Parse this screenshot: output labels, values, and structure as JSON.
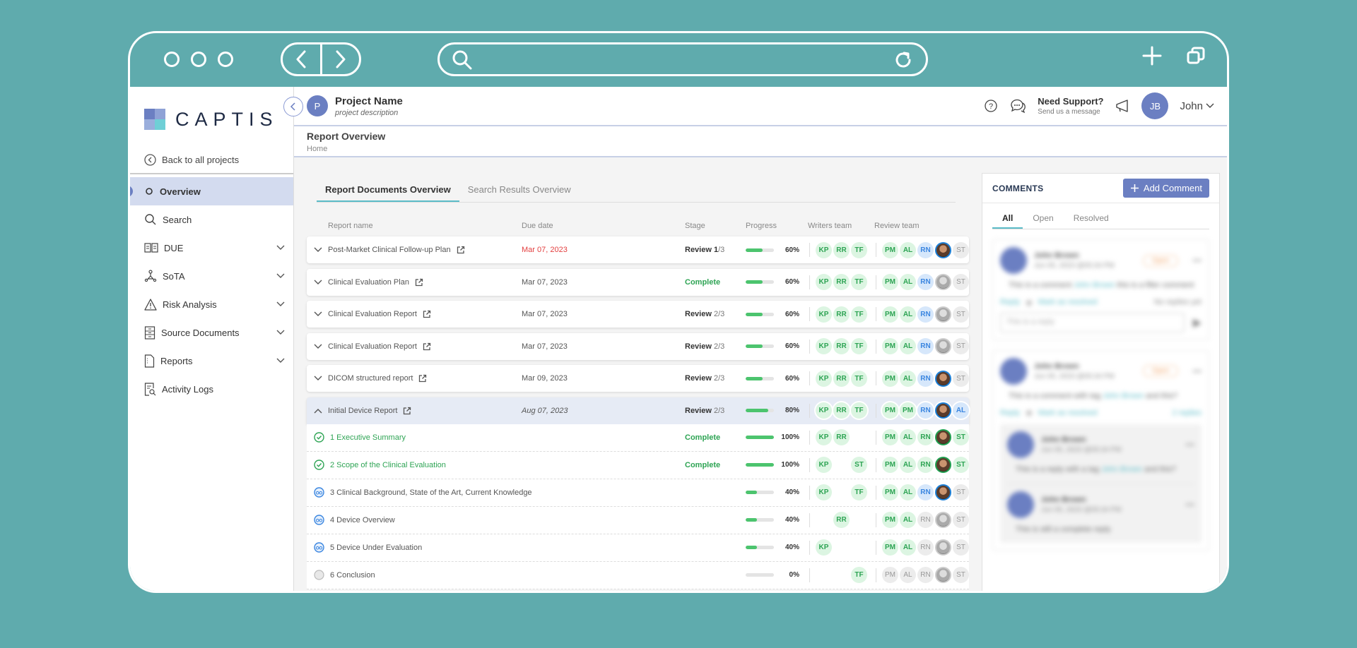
{
  "browser": {
    "icons": [
      "window-dot-icon",
      "back-icon",
      "forward-icon",
      "search-icon",
      "reload-icon",
      "new-tab-icon",
      "tabs-icon"
    ]
  },
  "sidebar": {
    "logo_text": "CAPTIS",
    "back_label": "Back to all projects",
    "items": [
      {
        "label": "Overview",
        "icon": "circle-icon",
        "active": true,
        "expandable": false
      },
      {
        "label": "Search",
        "icon": "search-icon",
        "active": false,
        "expandable": false
      },
      {
        "label": "DUE",
        "icon": "book-icon",
        "active": false,
        "expandable": true
      },
      {
        "label": "SoTA",
        "icon": "network-icon",
        "active": false,
        "expandable": true
      },
      {
        "label": "Risk Analysis",
        "icon": "warning-icon",
        "active": false,
        "expandable": true
      },
      {
        "label": "Source Documents",
        "icon": "cabinet-icon",
        "active": false,
        "expandable": true
      },
      {
        "label": "Reports",
        "icon": "document-icon",
        "active": false,
        "expandable": true
      },
      {
        "label": "Activity Logs",
        "icon": "log-search-icon",
        "active": false,
        "expandable": false
      }
    ]
  },
  "topbar": {
    "project_initial": "P",
    "project_name": "Project Name",
    "project_description": "project description",
    "support_title": "Need Support?",
    "support_subtitle": "Send us a message",
    "user_initials": "JB",
    "user_name": "John"
  },
  "page": {
    "title": "Report Overview",
    "breadcrumb": "Home"
  },
  "tabs": [
    {
      "label": "Report Documents Overview",
      "active": true
    },
    {
      "label": "Search Results Overview",
      "active": false
    }
  ],
  "table": {
    "headers": {
      "name": "Report name",
      "due": "Due date",
      "stage": "Stage",
      "progress": "Progress",
      "writers": "Writers team",
      "review": "Review team"
    },
    "rows": [
      {
        "name": "Post-Market Clinical Follow-up Plan",
        "due": "Mar 07, 2023",
        "due_state": "overdue",
        "stage": {
          "type": "review",
          "word": "Review",
          "current": "1",
          "total": "/3"
        },
        "progress": 60,
        "progress_label": "60%",
        "writers": [
          {
            "i": "KP",
            "c": "green"
          },
          {
            "i": "RR",
            "c": "green"
          },
          {
            "i": "TF",
            "c": "green"
          }
        ],
        "review": [
          {
            "i": "PM",
            "c": "green"
          },
          {
            "i": "AL",
            "c": "green"
          },
          {
            "i": "RN",
            "c": "blue"
          },
          {
            "i": "",
            "c": "photo"
          },
          {
            "i": "ST",
            "c": "gray"
          }
        ]
      },
      {
        "name": "Clinical Evaluation Plan",
        "due": "Mar 07, 2023",
        "due_state": "normal",
        "stage": {
          "type": "complete",
          "word": "Complete"
        },
        "progress": 60,
        "progress_label": "60%",
        "writers": [
          {
            "i": "KP",
            "c": "green"
          },
          {
            "i": "RR",
            "c": "green"
          },
          {
            "i": "TF",
            "c": "green"
          }
        ],
        "review": [
          {
            "i": "PM",
            "c": "green"
          },
          {
            "i": "AL",
            "c": "green"
          },
          {
            "i": "RN",
            "c": "blue"
          },
          {
            "i": "",
            "c": "photo-gray"
          },
          {
            "i": "ST",
            "c": "gray"
          }
        ]
      },
      {
        "name": "Clinical Evaluation Report",
        "due": "Mar 07, 2023",
        "due_state": "normal",
        "stage": {
          "type": "review",
          "word": "Review",
          "current": "",
          "total": "2/3"
        },
        "progress": 60,
        "progress_label": "60%",
        "writers": [
          {
            "i": "KP",
            "c": "green"
          },
          {
            "i": "RR",
            "c": "green"
          },
          {
            "i": "TF",
            "c": "green"
          }
        ],
        "review": [
          {
            "i": "PM",
            "c": "green"
          },
          {
            "i": "AL",
            "c": "green"
          },
          {
            "i": "RN",
            "c": "blue"
          },
          {
            "i": "",
            "c": "photo-gray"
          },
          {
            "i": "ST",
            "c": "gray"
          }
        ]
      },
      {
        "name": "Clinical Evaluation Report",
        "due": "Mar 07, 2023",
        "due_state": "normal",
        "stage": {
          "type": "review",
          "word": "Review",
          "current": "",
          "total": "2/3"
        },
        "progress": 60,
        "progress_label": "60%",
        "writers": [
          {
            "i": "KP",
            "c": "green"
          },
          {
            "i": "RR",
            "c": "green"
          },
          {
            "i": "TF",
            "c": "green"
          }
        ],
        "review": [
          {
            "i": "PM",
            "c": "green"
          },
          {
            "i": "AL",
            "c": "green"
          },
          {
            "i": "RN",
            "c": "blue"
          },
          {
            "i": "",
            "c": "photo-gray"
          },
          {
            "i": "ST",
            "c": "gray"
          }
        ]
      },
      {
        "name": "DICOM structured report",
        "due": "Mar 09, 2023",
        "due_state": "normal",
        "stage": {
          "type": "review",
          "word": "Review",
          "current": "",
          "total": "2/3"
        },
        "progress": 60,
        "progress_label": "60%",
        "writers": [
          {
            "i": "KP",
            "c": "green"
          },
          {
            "i": "RR",
            "c": "green"
          },
          {
            "i": "TF",
            "c": "green"
          }
        ],
        "review": [
          {
            "i": "PM",
            "c": "green"
          },
          {
            "i": "AL",
            "c": "green"
          },
          {
            "i": "RN",
            "c": "blue"
          },
          {
            "i": "",
            "c": "photo"
          },
          {
            "i": "ST",
            "c": "gray"
          }
        ]
      },
      {
        "name": "Initial Device Report",
        "due": "Aug 07, 2023",
        "due_state": "italic",
        "expanded": true,
        "stage": {
          "type": "review",
          "word": "Review",
          "current": "",
          "total": "2/3"
        },
        "progress": 80,
        "progress_label": "80%",
        "writers": [
          {
            "i": "KP",
            "c": "green"
          },
          {
            "i": "RR",
            "c": "green"
          },
          {
            "i": "TF",
            "c": "green"
          }
        ],
        "review": [
          {
            "i": "PM",
            "c": "green"
          },
          {
            "i": "PM",
            "c": "green"
          },
          {
            "i": "RN",
            "c": "blue"
          },
          {
            "i": "",
            "c": "photo"
          },
          {
            "i": "AL",
            "c": "blue"
          }
        ],
        "sections": [
          {
            "name": "1 Executive Summary",
            "status": "complete",
            "stage": "Complete",
            "progress": 100,
            "progress_label": "100%",
            "writers": [
              {
                "i": "KP",
                "c": "green"
              },
              {
                "i": "RR",
                "c": "green"
              },
              {
                "i": "",
                "c": "empty"
              }
            ],
            "review": [
              {
                "i": "PM",
                "c": "green"
              },
              {
                "i": "AL",
                "c": "green"
              },
              {
                "i": "RN",
                "c": "green"
              },
              {
                "i": "",
                "c": "photo-green"
              },
              {
                "i": "ST",
                "c": "green"
              }
            ]
          },
          {
            "name": "2 Scope of the Clinical Evaluation",
            "status": "complete",
            "stage": "Complete",
            "progress": 100,
            "progress_label": "100%",
            "writers": [
              {
                "i": "KP",
                "c": "green"
              },
              {
                "i": "",
                "c": "empty"
              },
              {
                "i": "ST",
                "c": "green"
              }
            ],
            "review": [
              {
                "i": "PM",
                "c": "green"
              },
              {
                "i": "AL",
                "c": "green"
              },
              {
                "i": "RN",
                "c": "green"
              },
              {
                "i": "",
                "c": "photo-green"
              },
              {
                "i": "ST",
                "c": "green"
              }
            ]
          },
          {
            "name": "3 Clinical Background, State of the Art, Current Knowledge",
            "status": "review",
            "stage": "",
            "progress": 40,
            "progress_label": "40%",
            "writers": [
              {
                "i": "KP",
                "c": "green"
              },
              {
                "i": "",
                "c": "empty"
              },
              {
                "i": "TF",
                "c": "green"
              }
            ],
            "review": [
              {
                "i": "PM",
                "c": "green"
              },
              {
                "i": "AL",
                "c": "green"
              },
              {
                "i": "RN",
                "c": "blue"
              },
              {
                "i": "",
                "c": "photo"
              },
              {
                "i": "ST",
                "c": "gray"
              }
            ]
          },
          {
            "name": "4 Device Overview",
            "status": "review",
            "stage": "",
            "progress": 40,
            "progress_label": "40%",
            "writers": [
              {
                "i": "",
                "c": "empty"
              },
              {
                "i": "RR",
                "c": "green"
              },
              {
                "i": "",
                "c": "empty"
              }
            ],
            "review": [
              {
                "i": "PM",
                "c": "green"
              },
              {
                "i": "AL",
                "c": "green"
              },
              {
                "i": "RN",
                "c": "gray"
              },
              {
                "i": "",
                "c": "photo-gray"
              },
              {
                "i": "ST",
                "c": "gray"
              }
            ]
          },
          {
            "name": "5 Device Under Evaluation",
            "status": "review",
            "stage": "",
            "progress": 40,
            "progress_label": "40%",
            "writers": [
              {
                "i": "KP",
                "c": "green"
              },
              {
                "i": "",
                "c": "empty"
              },
              {
                "i": "",
                "c": "empty"
              }
            ],
            "review": [
              {
                "i": "PM",
                "c": "green"
              },
              {
                "i": "AL",
                "c": "green"
              },
              {
                "i": "RN",
                "c": "gray"
              },
              {
                "i": "",
                "c": "photo-gray"
              },
              {
                "i": "ST",
                "c": "gray"
              }
            ]
          },
          {
            "name": "6 Conclusion",
            "status": "pending",
            "stage": "",
            "progress": 0,
            "progress_label": "0%",
            "writers": [
              {
                "i": "",
                "c": "empty"
              },
              {
                "i": "",
                "c": "empty"
              },
              {
                "i": "TF",
                "c": "green"
              }
            ],
            "review": [
              {
                "i": "PM",
                "c": "gray"
              },
              {
                "i": "AL",
                "c": "gray"
              },
              {
                "i": "RN",
                "c": "gray"
              },
              {
                "i": "",
                "c": "photo-gray"
              },
              {
                "i": "ST",
                "c": "gray"
              }
            ]
          }
        ]
      }
    ]
  },
  "comments": {
    "title": "COMMENTS",
    "add_label": "Add Comment",
    "tabs": [
      {
        "label": "All",
        "active": true
      },
      {
        "label": "Open",
        "active": false
      },
      {
        "label": "Resolved",
        "active": false
      }
    ],
    "blurred": true,
    "cards": [
      {
        "author": "John Brown",
        "date": "Jun 05, 2023 @05:34 PM",
        "badge": "Open",
        "body_pre": "This is a comment ",
        "mention": "John Brown",
        "body_post": " this is a filler comment",
        "reply": "Reply",
        "resolve": "Mark as resolved",
        "replies": "No replies yet",
        "input_placeholder": "This is a reply"
      },
      {
        "author": "John Brown",
        "date": "Jun 05, 2023 @05:34 PM",
        "badge": "Open",
        "body_pre": "This is a comment with tag ",
        "mention": "John Brown",
        "body_post": " and this?",
        "reply": "Reply",
        "resolve": "Mark as resolved",
        "replies": "2 replies",
        "thread": [
          {
            "author": "John Brown",
            "date": "Jun 05, 2023 @05:34 PM",
            "body_pre": "This is a reply with a tag ",
            "mention": "John Brown",
            "body_post": " and this?"
          },
          {
            "author": "John Brown",
            "date": "Jun 05, 2023 @05:34 PM",
            "body_pre": "This is still a complete reply",
            "mention": "",
            "body_post": ""
          }
        ]
      }
    ]
  },
  "colors": {
    "brand": "#6b7fc2",
    "accent_teal": "#5bbcc8",
    "success": "#2ea454",
    "progress": "#4cc46e",
    "overdue": "#e34040",
    "background": "#5fabad"
  }
}
